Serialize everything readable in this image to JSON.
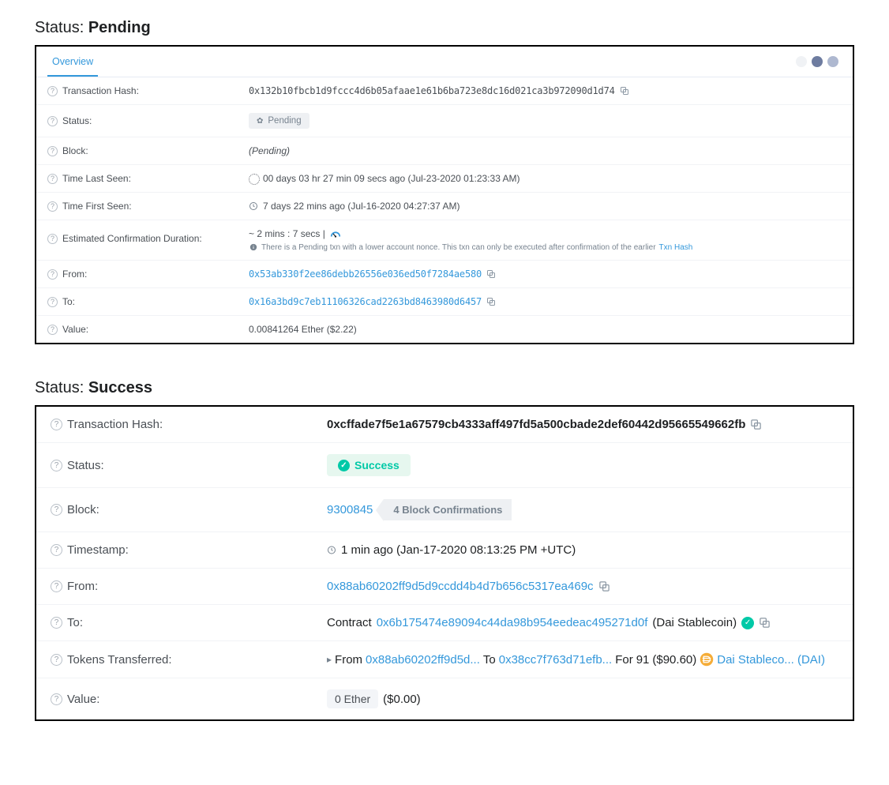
{
  "headings": {
    "pending_prefix": "Status: ",
    "pending_value": "Pending",
    "success_prefix": "Status: ",
    "success_value": "Success"
  },
  "pending": {
    "tab": "Overview",
    "hash_label": "Transaction Hash:",
    "hash": "0x132b10fbcb1d9fccc4d6b05afaae1e61b6ba723e8dc16d021ca3b972090d1d74",
    "status_label": "Status:",
    "status_badge": "Pending",
    "block_label": "Block:",
    "block_value": "(Pending)",
    "time_last_label": "Time Last Seen:",
    "time_last_value": "00 days 03 hr 27 min 09 secs ago (Jul-23-2020 01:23:33 AM)",
    "time_first_label": "Time First Seen:",
    "time_first_value": "7 days 22 mins ago (Jul-16-2020 04:27:37 AM)",
    "est_label": "Estimated Confirmation Duration:",
    "est_value": "~ 2 mins : 7 secs |",
    "est_note_prefix": "There is a Pending txn with a lower account nonce. This txn can only be executed after confirmation of the earlier ",
    "est_note_link": "Txn Hash",
    "from_label": "From:",
    "from_addr": "0x53ab330f2ee86debb26556e036ed50f7284ae580",
    "to_label": "To:",
    "to_addr": "0x16a3bd9c7eb11106326cad2263bd8463980d6457",
    "value_label": "Value:",
    "value_text": "0.00841264 Ether ($2.22)"
  },
  "success": {
    "hash_label": "Transaction Hash:",
    "hash": "0xcffade7f5e1a67579cb4333aff497fd5a500cbade2def60442d95665549662fb",
    "status_label": "Status:",
    "status_badge": "Success",
    "block_label": "Block:",
    "block_number": "9300845",
    "block_confirm": "4 Block Confirmations",
    "ts_label": "Timestamp:",
    "ts_value": "1 min ago (Jan-17-2020 08:13:25 PM +UTC)",
    "from_label": "From:",
    "from_addr": "0x88ab60202ff9d5d9ccdd4b4d7b656c5317ea469c",
    "to_label": "To:",
    "to_prefix": "Contract",
    "to_addr": "0x6b175474e89094c44da98b954eedeac495271d0f",
    "to_suffix": "(Dai Stablecoin)",
    "tokens_label": "Tokens Transferred:",
    "tt_from_lbl": "From",
    "tt_from_addr": "0x88ab60202ff9d5d...",
    "tt_to_lbl": "To",
    "tt_to_addr": "0x38cc7f763d71efb...",
    "tt_for_lbl": "For",
    "tt_amount": "91",
    "tt_usd": "($90.60)",
    "tt_token": "Dai Stableco... (DAI)",
    "value_label": "Value:",
    "value_pill": "0 Ether",
    "value_usd": "($0.00)"
  }
}
